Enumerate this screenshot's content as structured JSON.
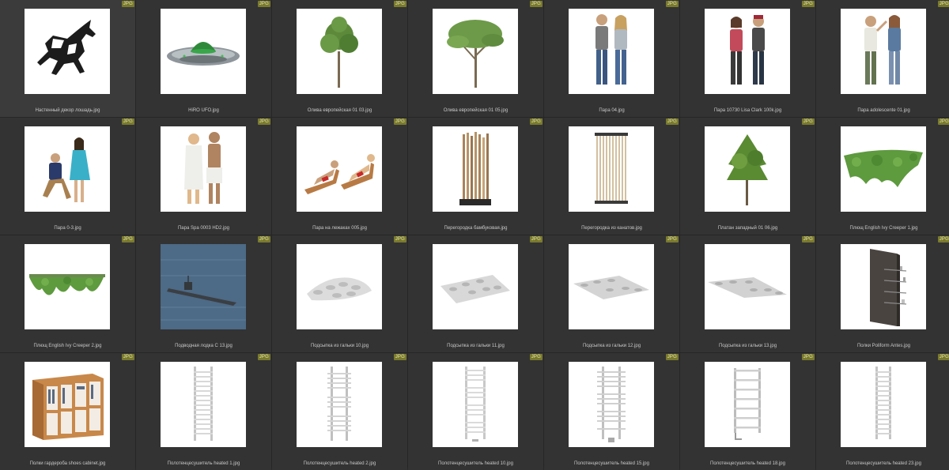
{
  "browser": {
    "badge_text": "JPG",
    "items": [
      {
        "name": "Настенный декор лошадь.jpg",
        "icon": "horse-icon"
      },
      {
        "name": "HiRO UFO.jpg",
        "icon": "ufo-icon"
      },
      {
        "name": "Олива европейская 01 03.jpg",
        "icon": "tree-icon"
      },
      {
        "name": "Олива европейская 01 05.jpg",
        "icon": "tree-icon"
      },
      {
        "name": "Пара 04.jpg",
        "icon": "couple-icon"
      },
      {
        "name": "Пара 10730 Lisa Clark 100k.jpg",
        "icon": "couple-icon"
      },
      {
        "name": "Пара adolescente 01.jpg",
        "icon": "couple-icon"
      },
      {
        "name": "Пара 0-3.jpg",
        "icon": "couple-icon"
      },
      {
        "name": "Пара Spa 0003 HD2.jpg",
        "icon": "couple-icon"
      },
      {
        "name": "Пара на лежаках 005.jpg",
        "icon": "loungers-icon"
      },
      {
        "name": "Перегородка бамбуковая.jpg",
        "icon": "bamboo-partition-icon"
      },
      {
        "name": "Перегородка из канатов.jpg",
        "icon": "rope-partition-icon"
      },
      {
        "name": "Платан западный 01 06.jpg",
        "icon": "tree-icon"
      },
      {
        "name": "Плющ English Ivy Creeper 1.jpg",
        "icon": "ivy-icon"
      },
      {
        "name": "Плющ English Ivy Creeper 2.jpg",
        "icon": "ivy-icon"
      },
      {
        "name": "Подводная лодка С 13.jpg",
        "icon": "submarine-icon"
      },
      {
        "name": "Подсыпка из гальки 10.jpg",
        "icon": "pebbles-icon"
      },
      {
        "name": "Подсыпка из гальки 11.jpg",
        "icon": "pebbles-icon"
      },
      {
        "name": "Подсыпка из гальки 12.jpg",
        "icon": "pebbles-icon"
      },
      {
        "name": "Подсыпка из гальки 13.jpg",
        "icon": "pebbles-icon"
      },
      {
        "name": "Полки Poliform Antes.jpg",
        "icon": "shelf-icon"
      },
      {
        "name": "Полки гардероба shoes cabinet.jpg",
        "icon": "wardrobe-icon"
      },
      {
        "name": "Полотенцесушитель heated 1.jpg",
        "icon": "towel-rail-icon"
      },
      {
        "name": "Полотенцесушитель heated 2.jpg",
        "icon": "towel-rail-icon"
      },
      {
        "name": "Полотенцесушитель heated 10.jpg",
        "icon": "towel-rail-icon"
      },
      {
        "name": "Полотенцесушитель heated 15.jpg",
        "icon": "towel-rail-icon"
      },
      {
        "name": "Полотенцесушитель heated 18.jpg",
        "icon": "towel-rail-icon"
      },
      {
        "name": "Полотенцесушитель heated 23.jpg",
        "icon": "towel-rail-icon"
      }
    ]
  }
}
